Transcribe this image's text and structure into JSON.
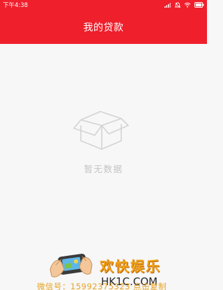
{
  "status_bar": {
    "time": "下午4:38",
    "icons": [
      "signal-icon",
      "alarm-icon",
      "wifi-icon",
      "battery-icon"
    ]
  },
  "header": {
    "title": "我的贷款"
  },
  "empty_state": {
    "icon": "empty-box-icon",
    "message": "暂无数据"
  },
  "watermark": {
    "brand": "欢快娱乐",
    "domain": "HK1C.COM",
    "wechat": "微信号：15992375323 点击复制"
  },
  "colors": {
    "header_bg": "#ef1f2c",
    "page_bg": "#f7f7f7",
    "empty_text": "#c4c4c4",
    "brand_orange": "#f0a018"
  }
}
